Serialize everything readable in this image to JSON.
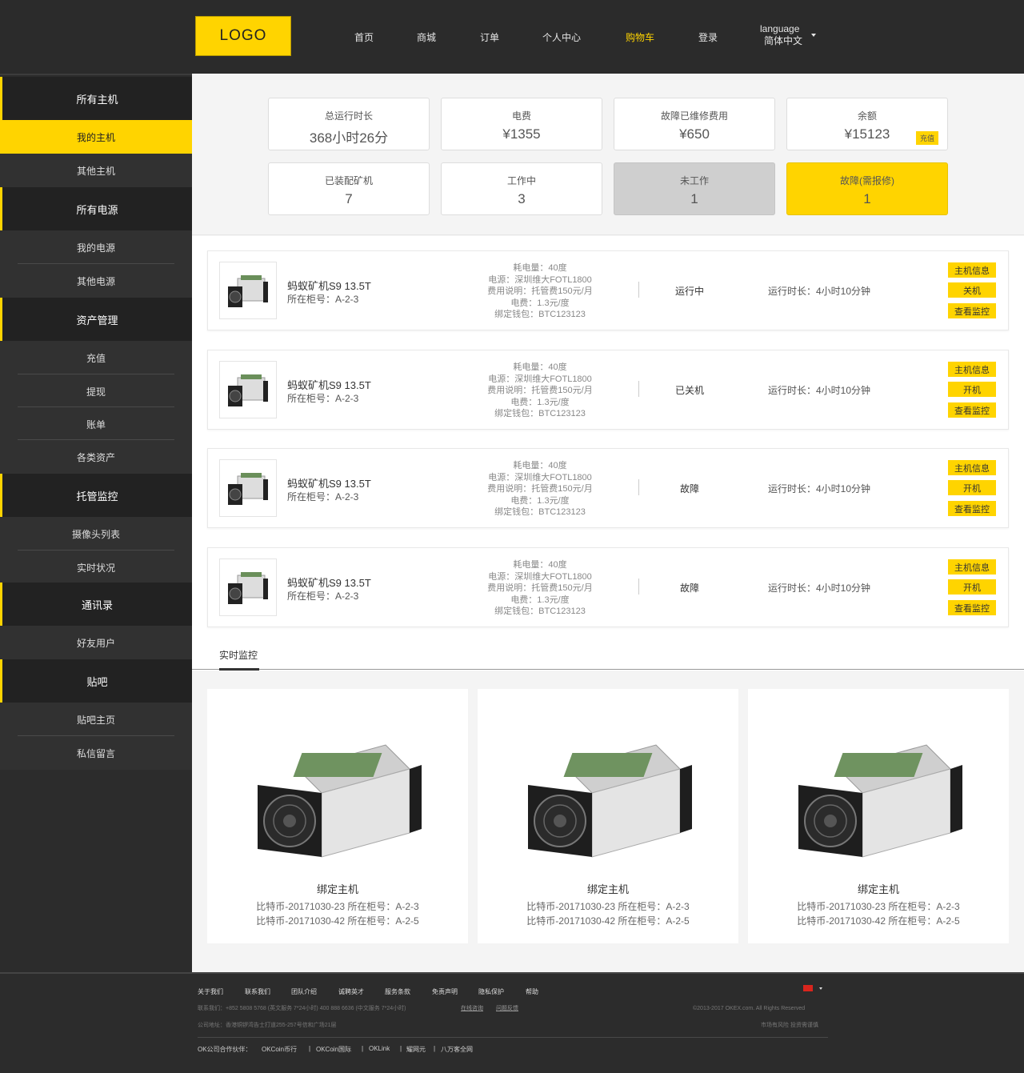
{
  "header": {
    "logo": "LOGO",
    "nav": [
      {
        "label": "首页",
        "active": false
      },
      {
        "label": "商城",
        "active": false
      },
      {
        "label": "订单",
        "active": false
      },
      {
        "label": "个人中心",
        "active": false
      },
      {
        "label": "购物车",
        "active": true
      },
      {
        "label": "登录",
        "active": false
      }
    ],
    "language_label": "language",
    "language_value": "简体中文"
  },
  "sidebar": {
    "groups": [
      {
        "label": "所有主机",
        "items": [
          "我的主机",
          "其他主机"
        ]
      },
      {
        "label": "所有电源",
        "items": [
          "我的电源",
          "其他电源"
        ]
      },
      {
        "label": "资产管理",
        "items": [
          "充值",
          "提现",
          "账单",
          "各类资产"
        ]
      },
      {
        "label": "托管监控",
        "items": [
          "摄像头列表",
          "实时状况"
        ]
      },
      {
        "label": "通讯录",
        "items": [
          "好友用户"
        ]
      },
      {
        "label": "贴吧",
        "items": [
          "贴吧主页",
          "私信留言"
        ]
      }
    ],
    "active_item": "我的主机"
  },
  "stats": [
    {
      "label": "总运行时长",
      "value": "368小时26分",
      "style": "normal"
    },
    {
      "label": "电费",
      "value": "¥1355",
      "style": "normal"
    },
    {
      "label": "故障已维修费用",
      "value": "¥650",
      "style": "normal"
    },
    {
      "label": "余额",
      "value": "¥15123",
      "style": "normal",
      "action": "充值"
    },
    {
      "label": "已装配矿机",
      "value": "7",
      "style": "normal"
    },
    {
      "label": "工作中",
      "value": "3",
      "style": "normal"
    },
    {
      "label": "未工作",
      "value": "1",
      "style": "grey"
    },
    {
      "label": "故障(需报修)",
      "value": "1",
      "style": "yellow"
    }
  ],
  "machines": [
    {
      "name": "蚂蚁矿机S9 13.5T",
      "location": "所在柜号：A-2-3",
      "details": [
        "耗电量：40度",
        "电源：深圳维大FOTL1800",
        "费用说明：托管费150元/月",
        "电费：1.3元/度",
        "绑定钱包：BTC123123"
      ],
      "status": "运行中",
      "runtime": "运行时长：4小时10分钟",
      "buttons": [
        "主机信息",
        "关机",
        "查看监控"
      ]
    },
    {
      "name": "蚂蚁矿机S9 13.5T",
      "location": "所在柜号：A-2-3",
      "details": [
        "耗电量：40度",
        "电源：深圳维大FOTL1800",
        "费用说明：托管费150元/月",
        "电费：1.3元/度",
        "绑定钱包：BTC123123"
      ],
      "status": "已关机",
      "runtime": "运行时长：4小时10分钟",
      "buttons": [
        "主机信息",
        "开机",
        "查看监控"
      ]
    },
    {
      "name": "蚂蚁矿机S9 13.5T",
      "location": "所在柜号：A-2-3",
      "details": [
        "耗电量：40度",
        "电源：深圳维大FOTL1800",
        "费用说明：托管费150元/月",
        "电费：1.3元/度",
        "绑定钱包：BTC123123"
      ],
      "status": "故障",
      "runtime": "运行时长：4小时10分钟",
      "buttons": [
        "主机信息",
        "开机",
        "查看监控"
      ]
    },
    {
      "name": "蚂蚁矿机S9 13.5T",
      "location": "所在柜号：A-2-3",
      "details": [
        "耗电量：40度",
        "电源：深圳维大FOTL1800",
        "费用说明：托管费150元/月",
        "电费：1.3元/度",
        "绑定钱包：BTC123123"
      ],
      "status": "故障",
      "runtime": "运行时长：4小时10分钟",
      "buttons": [
        "主机信息",
        "开机",
        "查看监控"
      ]
    }
  ],
  "monitor": {
    "tab": "实时监控",
    "cards": [
      {
        "title": "绑定主机",
        "lines": [
          "比特币-20171030-23  所在柜号：A-2-3",
          "比特币-20171030-42  所在柜号：A-2-5"
        ]
      },
      {
        "title": "绑定主机",
        "lines": [
          "比特币-20171030-23  所在柜号：A-2-3",
          "比特币-20171030-42  所在柜号：A-2-5"
        ]
      },
      {
        "title": "绑定主机",
        "lines": [
          "比特币-20171030-23  所在柜号：A-2-3",
          "比特币-20171030-42  所在柜号：A-2-5"
        ]
      }
    ]
  },
  "footer": {
    "links": [
      "关于我们",
      "联系我们",
      "团队介绍",
      "诚聘英才",
      "服务条款",
      "免责声明",
      "隐私保护",
      "帮助"
    ],
    "contact": "联系我们：+852 5808 5768 (英文服务 7*24小时)    400 888 6636 (中文服务 7*24小时)",
    "contact_links": [
      "在线咨询",
      "问题反馈"
    ],
    "address": "公司地址：香港铜锣湾告士打道255-257号信和广场21层",
    "copyright": "©2013-2017 OKEX.com. All Rights Reserved",
    "risk": "市场有风险 投资需谨慎",
    "partners_label": "OK公司合作伙伴：",
    "partners": [
      "OKCoin币行",
      "OKCoin国际",
      "OKLink",
      "耀网元",
      "八万客全网"
    ]
  },
  "colors": {
    "accent": "#ffd400",
    "dark": "#2b2b2b"
  }
}
